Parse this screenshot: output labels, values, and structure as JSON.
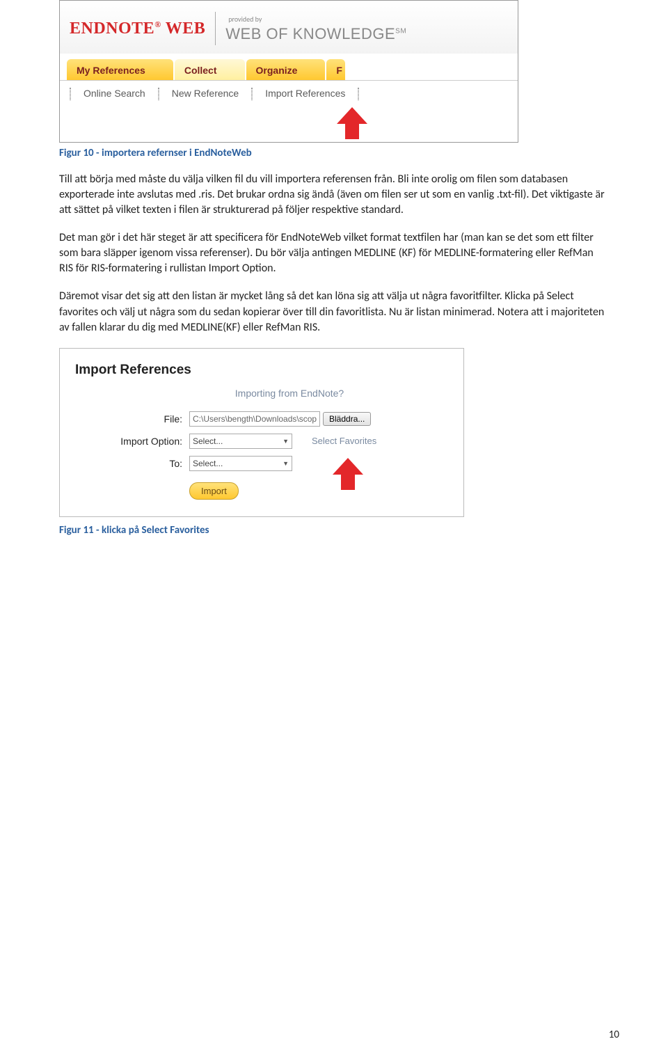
{
  "shot1": {
    "endnote": "ENDNOTE",
    "web": "WEB",
    "providedBy": "provided by",
    "wok": "WEB OF KNOWLEDGE",
    "tabs": {
      "myRefs": "My References",
      "collect": "Collect",
      "organize": "Organize",
      "partial": "F"
    },
    "subnav": {
      "onlineSearch": "Online Search",
      "newReference": "New Reference",
      "importReferences": "Import References"
    }
  },
  "caption1": "Figur 10 - importera refernser i EndNoteWeb",
  "para1": "Till att börja med måste du välja vilken fil du vill importera referensen från. Bli inte orolig om filen som databasen exporterade inte avslutas med .ris. Det brukar ordna sig ändå (även om filen ser ut som en vanlig .txt-fil). Det viktigaste är att sättet på vilket texten i filen är strukturerad på följer respektive standard.",
  "para2": "Det man gör i det här steget är att specificera för EndNoteWeb vilket format textfilen har (man kan se det som ett filter som bara släpper igenom vissa referenser). Du bör välja antingen MEDLINE (KF) för MEDLINE-formatering eller RefMan RIS för RIS-formatering i rullistan Import Option.",
  "para3": "Däremot visar det sig att den listan är mycket lång så det kan löna sig att välja ut några favoritfilter. Klicka på Select favorites och välj ut några som du sedan kopierar över till din favoritlista. Nu är listan minimerad. Notera att i majoriteten av fallen klarar du dig med MEDLINE(KF) eller RefMan RIS.",
  "shot2": {
    "title": "Import References",
    "sub": "Importing from EndNote?",
    "fileLabel": "File:",
    "fileValue": "C:\\Users\\bength\\Downloads\\scopus.ri",
    "browse": "Bläddra...",
    "importOptionLabel": "Import Option:",
    "selectText": "Select...",
    "selectFavorites": "Select Favorites",
    "toLabel": "To:",
    "importBtn": "Import"
  },
  "caption2": "Figur 11 - klicka på Select Favorites",
  "pageNumber": "10"
}
